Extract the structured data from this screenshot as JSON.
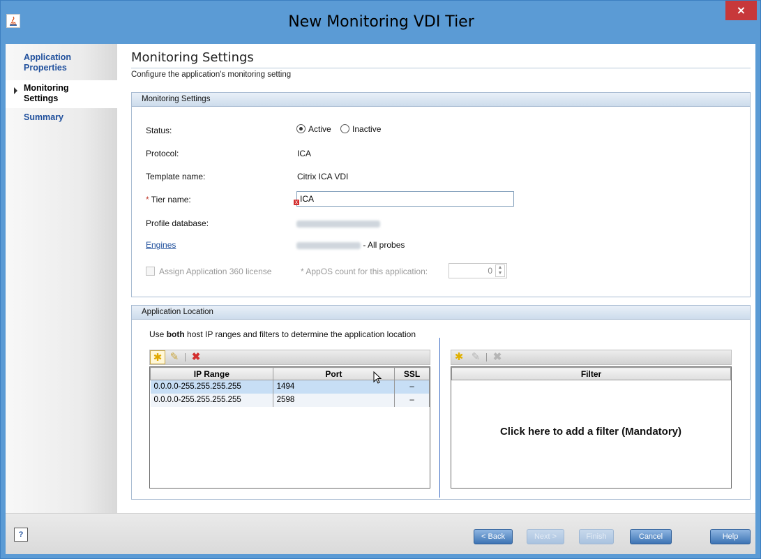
{
  "window": {
    "title": "New Monitoring VDI Tier",
    "close_glyph": "×"
  },
  "sidebar": {
    "items": [
      {
        "label_line1": "Application",
        "label_line2": "Properties"
      },
      {
        "label_line1": "Monitoring",
        "label_line2": "Settings"
      },
      {
        "label_line1": "Summary",
        "label_line2": ""
      }
    ],
    "active_index": 1
  },
  "page": {
    "title": "Monitoring Settings",
    "subtitle": "Configure the application's monitoring setting"
  },
  "monitoring": {
    "header": "Monitoring Settings",
    "status_label": "Status:",
    "status_active": "Active",
    "status_inactive": "Inactive",
    "status_selected": "Active",
    "protocol_label": "Protocol:",
    "protocol_value": "ICA",
    "template_label": "Template name:",
    "template_value": "Citrix ICA VDI",
    "tier_required_mark": "*",
    "tier_label": "Tier name:",
    "tier_value": "ICA",
    "profile_label": "Profile database:",
    "engines_link": "Engines",
    "engines_suffix": "- All probes",
    "license_label": "Assign Application 360 license",
    "appos_label": "AppOS count for this application:",
    "appos_value": "0"
  },
  "location": {
    "header": "Application Location",
    "instruction_pre": "Use",
    "instruction_bold": "both",
    "instruction_post": "host IP ranges and filters to determine the application location",
    "ip_columns": [
      "IP Range",
      "Port",
      "SSL"
    ],
    "ip_rows": [
      {
        "range": "0.0.0.0-255.255.255.255",
        "port": "1494",
        "ssl": "–"
      },
      {
        "range": "0.0.0.0-255.255.255.255",
        "port": "2598",
        "ssl": "–"
      }
    ],
    "filter_column": "Filter",
    "filter_hint": "Click here to add a filter (Mandatory)"
  },
  "footer": {
    "back": "< Back",
    "next": "Next >",
    "finish": "Finish",
    "cancel": "Cancel",
    "help": "Help"
  },
  "colors": {
    "accent": "#5b9bd5",
    "link": "#1f4f9c",
    "close": "#c7383a"
  }
}
